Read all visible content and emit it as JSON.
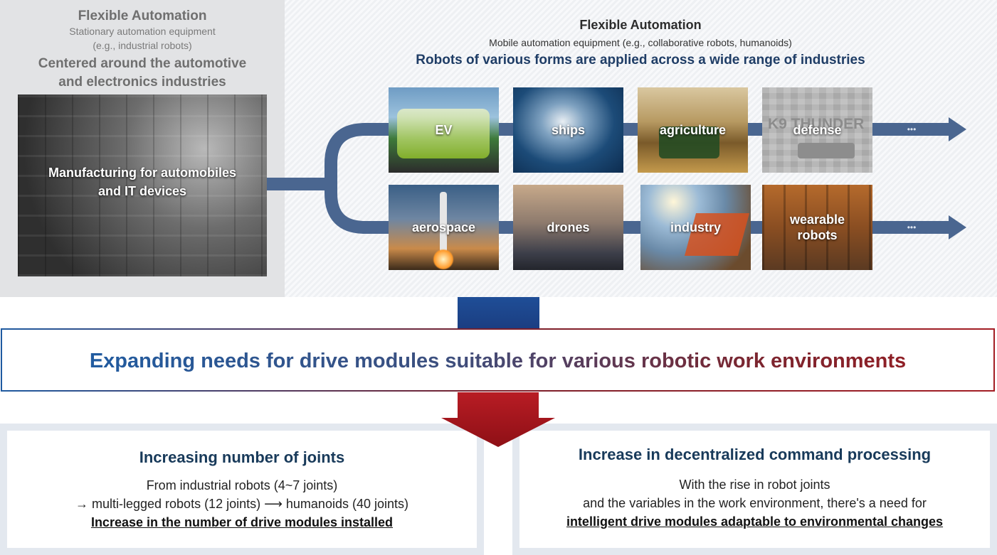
{
  "left_panel": {
    "title": "Flexible Automation",
    "subtitle_line1": "Stationary automation equipment",
    "subtitle_line2": "(e.g., industrial robots)",
    "focus_line1": "Centered around the automotive",
    "focus_line2": "and electronics industries",
    "image_label_line1": "Manufacturing for automobiles",
    "image_label_line2": "and IT devices"
  },
  "right_panel": {
    "title": "Flexible Automation",
    "subtitle": "Mobile automation equipment (e.g., collaborative robots, humanoids)",
    "headline": "Robots of various forms are applied across a wide range of industries",
    "row1": [
      "EV",
      "ships",
      "agriculture",
      "defense"
    ],
    "row2": [
      "aerospace",
      "drones",
      "industry",
      "wearable robots"
    ],
    "tile_overlay_text": "K9 THUNDER",
    "ellipsis": "•••"
  },
  "banner": {
    "text": "Expanding needs for drive modules suitable for various robotic work environments"
  },
  "box_left": {
    "title": "Increasing number of joints",
    "line1": "From industrial robots (4~7 joints)",
    "line2": "→ multi-legged robots (12 joints) ⟶ humanoids (40 joints)",
    "emphasis": "Increase in the number of drive modules installed"
  },
  "box_right": {
    "title": "Increase in decentralized command processing",
    "line1": "With the rise in robot joints",
    "line2": "and the variables in the work environment, there's a need for",
    "emphasis": "intelligent drive modules adaptable to environmental changes"
  },
  "colors": {
    "flow_arrow": "#4a6690",
    "banner_blue": "#1a5ea8",
    "banner_red": "#9b1b20",
    "heading_navy": "#1f3d66"
  }
}
